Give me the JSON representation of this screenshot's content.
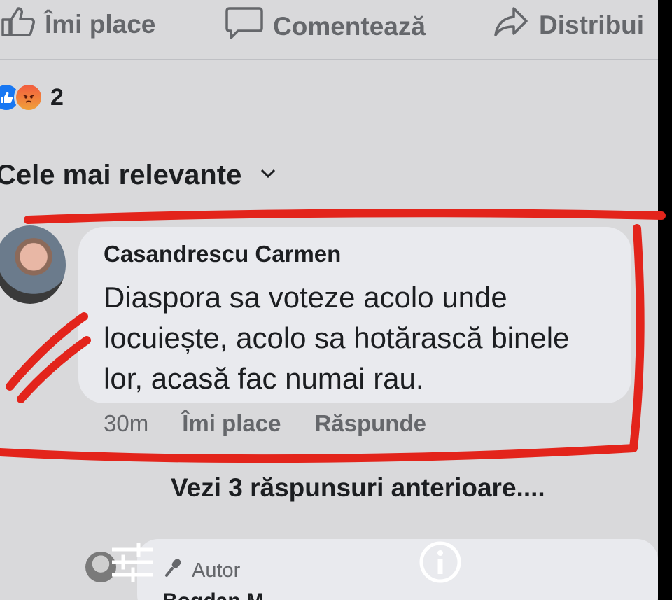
{
  "action_bar": {
    "like_label": "Îmi place",
    "comment_label": "Comentează",
    "share_label": "Distribui"
  },
  "reactions": {
    "icons": [
      "like-icon",
      "angry-icon"
    ],
    "count": "2"
  },
  "sort": {
    "label": "Cele mai relevante"
  },
  "comment": {
    "author": "Casandrescu Carmen",
    "lines": [
      "Diaspora sa voteze acolo unde",
      "locuiește, acolo sa hotărască binele",
      "lor, acasă fac numai rau."
    ],
    "time": "30m",
    "like_label": "Îmi place",
    "reply_label": "Răspunde"
  },
  "view_replies": "Vezi 3 răspunsuri anterioare....",
  "next_comment": {
    "badge": "Autor",
    "name_partial": "Bogdan M"
  },
  "colors": {
    "background": "#d9d9db",
    "bubble": "#e9eaee",
    "secondary_text": "#65676b",
    "annotation_red": "#e3241b"
  }
}
